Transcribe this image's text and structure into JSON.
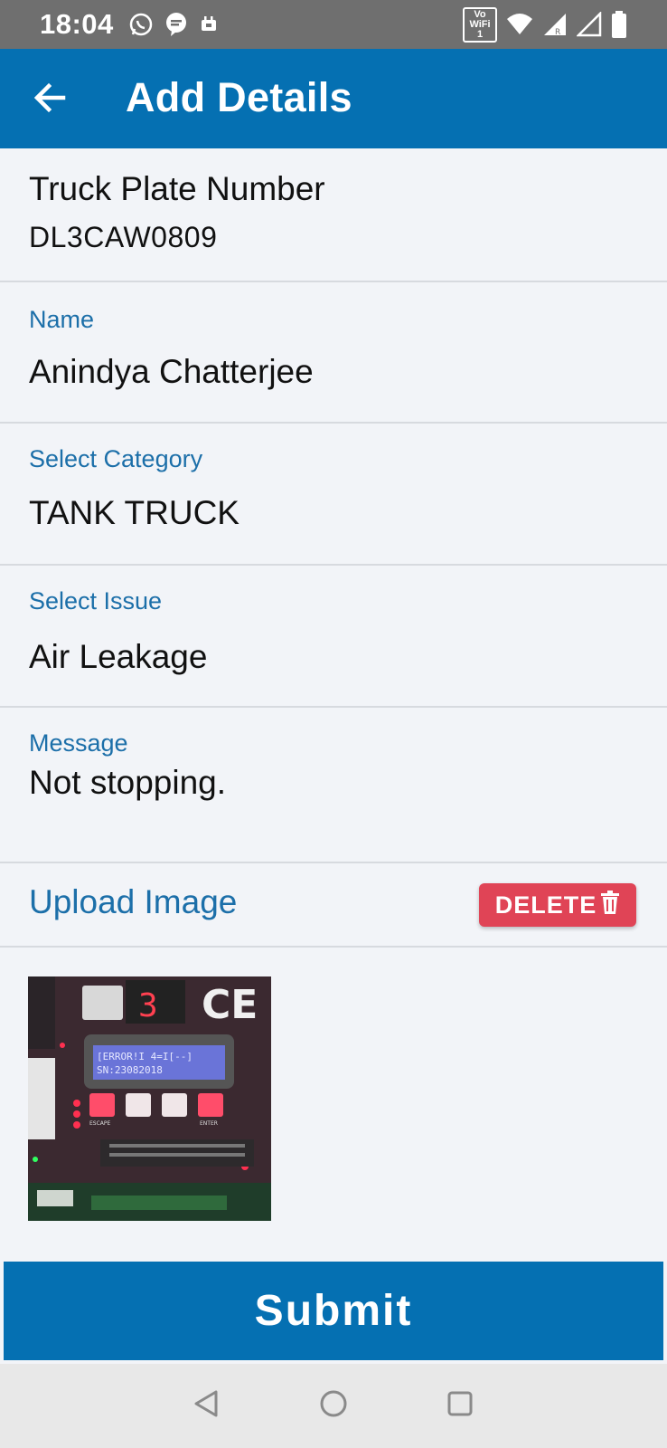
{
  "status_bar": {
    "time": "18:04",
    "wifi_calling": "Vo WiFi 1",
    "icons_left": [
      "whatsapp-icon",
      "chat-icon",
      "notification-icon"
    ],
    "icons_right": [
      "vowifi-icon",
      "wifi-icon",
      "signal-icon",
      "signal-icon-2",
      "battery-icon"
    ]
  },
  "app_bar": {
    "title": "Add Details",
    "back_icon": "arrow-left-icon"
  },
  "plate": {
    "label": "Truck Plate Number",
    "value": "DL3CAW0809"
  },
  "name": {
    "label": "Name",
    "value": "Anindya Chatterjee"
  },
  "category": {
    "label": "Select Category",
    "value": "TANK TRUCK"
  },
  "issue": {
    "label": "Select Issue",
    "value": "Air Leakage"
  },
  "message": {
    "label": "Message",
    "value": "Not stopping."
  },
  "upload": {
    "label": "Upload Image",
    "delete_label": "DELETE",
    "delete_icon": "trash-icon"
  },
  "photo": {
    "display_digit": "3",
    "ce_mark": "CE",
    "lcd_line1": "[ERROR!I  4=I[--]",
    "lcd_line2": "SN:23082018",
    "escape_label": "ESCAPE",
    "enter_label": "ENTER"
  },
  "submit": {
    "label": "Submit"
  },
  "colors": {
    "primary": "#0570b2",
    "label_blue": "#1c6fa9",
    "delete_red": "#e04456",
    "background": "#f2f4f8"
  }
}
